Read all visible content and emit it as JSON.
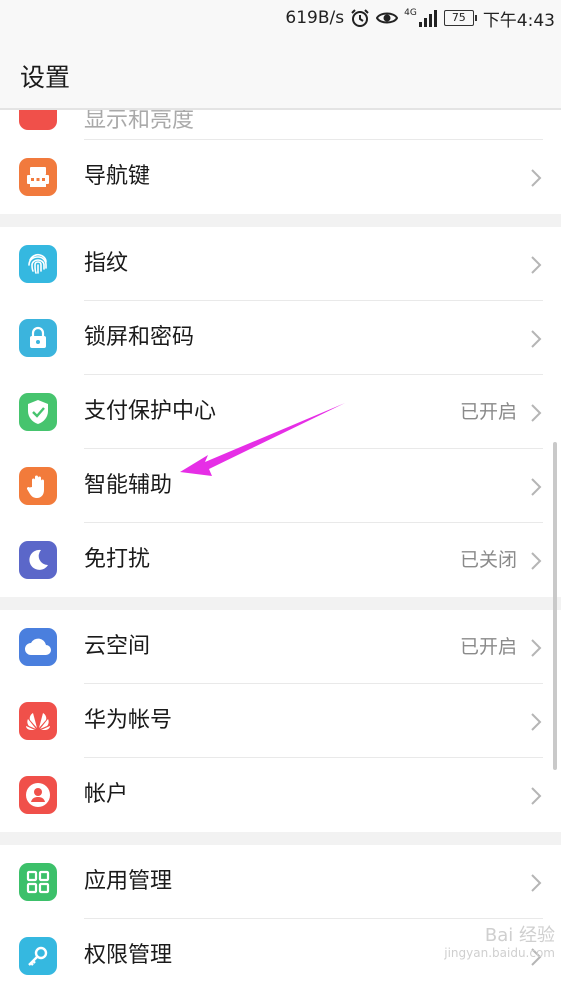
{
  "status_bar": {
    "net_speed": "619B/s",
    "network": "4G",
    "battery": "75",
    "time": "下午4:43"
  },
  "header": {
    "title": "设置"
  },
  "partial_item": {
    "label": "显示和亮度"
  },
  "groups": [
    [
      {
        "id": "nav-keys",
        "label": "导航键",
        "status": "",
        "icon": "nav-keys-icon",
        "color": "#f17a3d"
      }
    ],
    [
      {
        "id": "fingerprint",
        "label": "指纹",
        "status": "",
        "icon": "fingerprint-icon",
        "color": "#35b8e0"
      },
      {
        "id": "lock-screen",
        "label": "锁屏和密码",
        "status": "",
        "icon": "lock-icon",
        "color": "#3bb4dd"
      },
      {
        "id": "payment-protection",
        "label": "支付保护中心",
        "status": "已开启",
        "icon": "shield-icon",
        "color": "#46c46e"
      },
      {
        "id": "smart-assist",
        "label": "智能辅助",
        "status": "",
        "icon": "hand-icon",
        "color": "#f27b3b"
      },
      {
        "id": "do-not-disturb",
        "label": "免打扰",
        "status": "已关闭",
        "icon": "moon-icon",
        "color": "#5b67c9"
      }
    ],
    [
      {
        "id": "cloud",
        "label": "云空间",
        "status": "已开启",
        "icon": "cloud-icon",
        "color": "#4a7fde"
      },
      {
        "id": "huawei-account",
        "label": "华为帐号",
        "status": "",
        "icon": "huawei-logo-icon",
        "color": "#f0504a"
      },
      {
        "id": "accounts",
        "label": "帐户",
        "status": "",
        "icon": "user-icon",
        "color": "#f0504a"
      }
    ],
    [
      {
        "id": "app-management",
        "label": "应用管理",
        "status": "",
        "icon": "apps-grid-icon",
        "color": "#3cc06a"
      },
      {
        "id": "permission-management",
        "label": "权限管理",
        "status": "",
        "icon": "key-icon",
        "color": "#35b8e0"
      }
    ]
  ],
  "annotation": {
    "color": "#e62ee6",
    "target": "smart-assist"
  },
  "watermark": {
    "text": "Bai 经验",
    "url": "jingyan.baidu.com"
  }
}
